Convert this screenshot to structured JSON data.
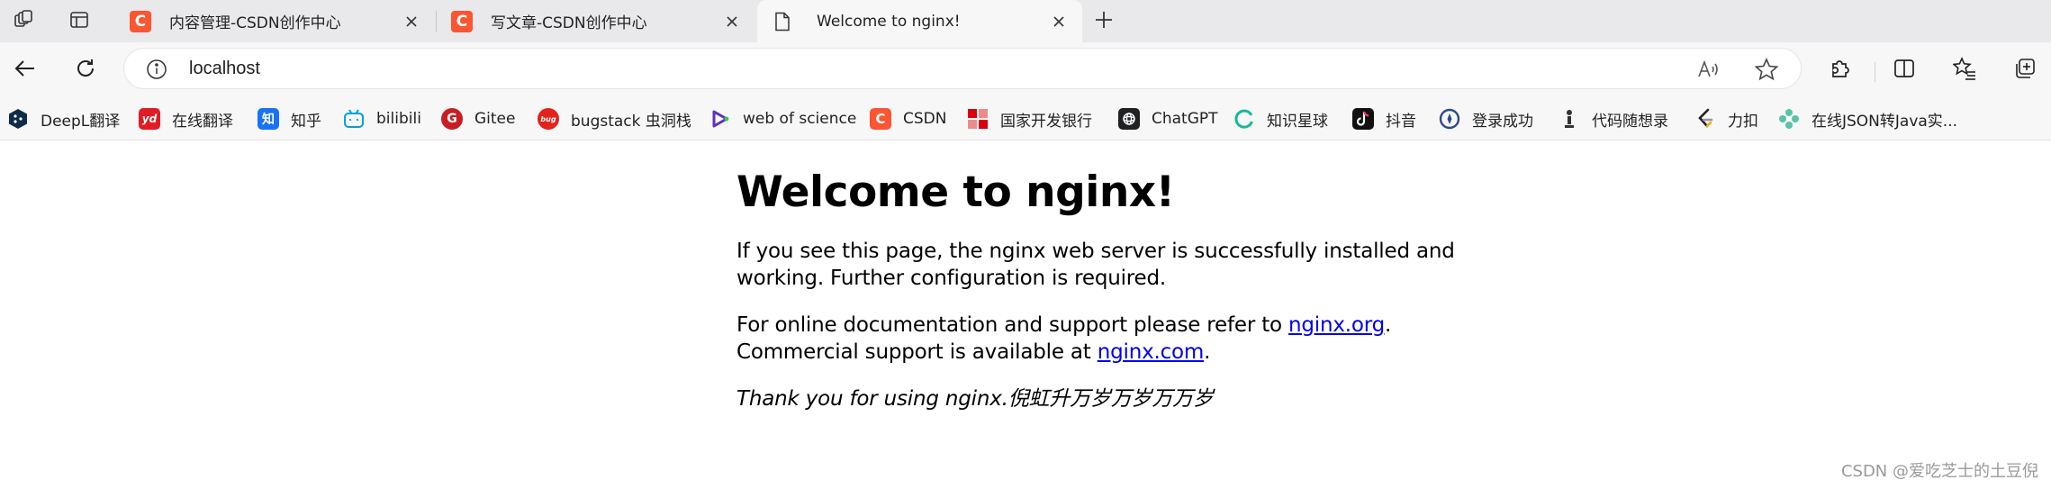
{
  "browser": {
    "tabs": [
      {
        "favicon": "C",
        "title": "内容管理-CSDN创作中心",
        "active": false
      },
      {
        "favicon": "C",
        "title": "写文章-CSDN创作中心",
        "active": false
      },
      {
        "favicon": "page-icon",
        "title": "Welcome to nginx!",
        "active": true
      }
    ],
    "new_tab_icon": "plus-icon",
    "address": "localhost",
    "colors": {
      "tabstrip": "#e9e9eb",
      "toolbar": "#f7f7f7",
      "csdn_red": "#fc5531",
      "link": "#0000ee"
    }
  },
  "bookmarks": [
    {
      "label": "DeepL翻译",
      "icon_text": "",
      "color": "#0f2b46"
    },
    {
      "label": "在线翻译",
      "icon_text": "yd",
      "color": "#e31b23"
    },
    {
      "label": "知乎",
      "icon_text": "知",
      "color": "#1772f6"
    },
    {
      "label": "bilibili",
      "icon_text": "",
      "color": "#00a1d6"
    },
    {
      "label": "Gitee",
      "icon_text": "G",
      "color": "#c71d23"
    },
    {
      "label": "bugstack 虫洞栈",
      "icon_text": "bug",
      "color": "#e2231a"
    },
    {
      "label": "web of science",
      "icon_text": "",
      "color": "#5e33bf"
    },
    {
      "label": "CSDN",
      "icon_text": "C",
      "color": "#fc5531"
    },
    {
      "label": "国家开发银行",
      "icon_text": "",
      "color": "#d7000f"
    },
    {
      "label": "ChatGPT",
      "icon_text": "",
      "color": "#202123"
    },
    {
      "label": "知识星球",
      "icon_text": "",
      "color": "#16b998"
    },
    {
      "label": "抖音",
      "icon_text": "",
      "color": "#111111"
    },
    {
      "label": "登录成功",
      "icon_text": "",
      "color": "#2c4a8c"
    },
    {
      "label": "代码随想录",
      "icon_text": "",
      "color": "#333333"
    },
    {
      "label": "力扣",
      "icon_text": "",
      "color": "#ffa116"
    },
    {
      "label": "在线JSON转Java实...",
      "icon_text": "",
      "color": "#57c4a8"
    }
  ],
  "page": {
    "heading": "Welcome to nginx!",
    "p1": "If you see this page, the nginx web server is successfully installed and working. Further configuration is required.",
    "p2_text_a": "For online documentation and support please refer to ",
    "p2_link_a": "nginx.org",
    "p2_text_b": ".",
    "p2_text_c": "Commercial support is available at ",
    "p2_link_b": "nginx.com",
    "p2_text_d": ".",
    "p3": "Thank you for using nginx.倪虹升万岁万岁万万岁"
  },
  "watermark": "CSDN @爱吃芝士的土豆倪"
}
